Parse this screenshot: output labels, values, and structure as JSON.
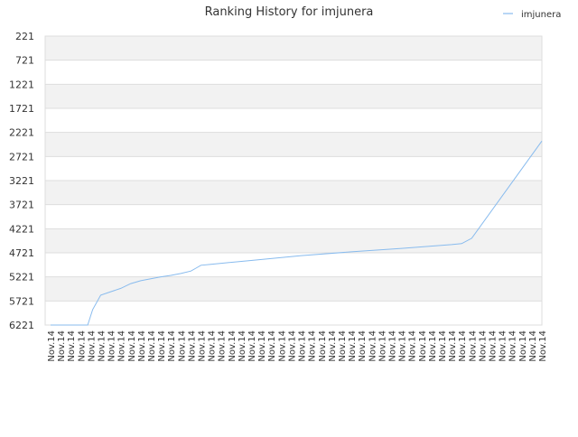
{
  "chart_data": {
    "type": "line",
    "title": "Ranking History for imjunera",
    "xlabel": "",
    "ylabel": "",
    "legend": {
      "position": "top-right",
      "entries": [
        "imjunera"
      ]
    },
    "y_reversed": true,
    "ylim": [
      221,
      6221
    ],
    "y_ticks": [
      221,
      721,
      1221,
      1721,
      2221,
      2721,
      3221,
      3721,
      4221,
      4721,
      5221,
      5721,
      6221
    ],
    "grid": true,
    "x_tick_labels": [
      "Nov.14",
      "Nov.14",
      "Nov.14",
      "Nov.14",
      "Nov.14",
      "Nov.14",
      "Nov.14",
      "Nov.14",
      "Nov.14",
      "Nov.14",
      "Nov.14",
      "Nov.14",
      "Nov.14",
      "Nov.14",
      "Nov.14",
      "Nov.14",
      "Nov.14",
      "Nov.14",
      "Nov.14",
      "Nov.14",
      "Nov.14",
      "Nov.14",
      "Nov.14",
      "Nov.14",
      "Nov.14",
      "Nov.14",
      "Nov.14",
      "Nov.14",
      "Nov.14",
      "Nov.14",
      "Nov.14",
      "Nov.14",
      "Nov.14",
      "Nov.14",
      "Nov.14",
      "Nov.14",
      "Nov.14",
      "Nov.14",
      "Nov.14",
      "Nov.14",
      "Nov.14",
      "Nov.14",
      "Nov.14",
      "Nov.14",
      "Nov.14",
      "Nov.14",
      "Nov.14",
      "Nov.14",
      "Nov.14",
      "Nov.14"
    ],
    "series": [
      {
        "name": "imjunera",
        "color": "#88bbee",
        "x": [
          0,
          2.5,
          3.7,
          4.2,
          5.0,
          6.0,
          7.0,
          8.0,
          9.0,
          10.0,
          11.0,
          12.0,
          13.0,
          14.0,
          14.5,
          15.0,
          16.0,
          20.0,
          25.0,
          30.0,
          35.0,
          40.0,
          41.0,
          42.0,
          49.0
        ],
        "y": [
          6221,
          6221,
          6221,
          5900,
          5600,
          5530,
          5460,
          5360,
          5300,
          5260,
          5220,
          5190,
          5150,
          5100,
          5040,
          4980,
          4960,
          4880,
          4780,
          4700,
          4630,
          4550,
          4530,
          4420,
          2400
        ]
      }
    ]
  }
}
